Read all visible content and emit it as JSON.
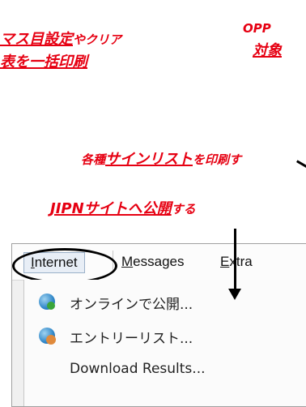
{
  "annotations": {
    "a1": {
      "strong": "マス目設定",
      "rest": "やクリア"
    },
    "a2": {
      "strong": "表を一括印刷"
    },
    "a3": {
      "text": "OPP"
    },
    "a4": {
      "strong": "対象"
    },
    "a5": {
      "prefix": "各種",
      "strong": "サインリスト",
      "rest": "を印刷す"
    },
    "a6": {
      "strong": "JIPNサイトへ公開",
      "rest": "する"
    }
  },
  "menubar": {
    "items": [
      {
        "pre": "",
        "ul": "I",
        "post": "nternet"
      },
      {
        "pre": "",
        "ul": "M",
        "post": "essages"
      },
      {
        "pre": "",
        "ul": "E",
        "post": "xtra"
      }
    ]
  },
  "dropdown": {
    "items": [
      {
        "label": "オンラインで公開...",
        "icon": "globe-icon"
      },
      {
        "label": "エントリーリスト...",
        "icon": "globe-user-icon"
      },
      {
        "label": "Download Results..."
      }
    ]
  },
  "colors": {
    "annotation": "#e60012"
  }
}
